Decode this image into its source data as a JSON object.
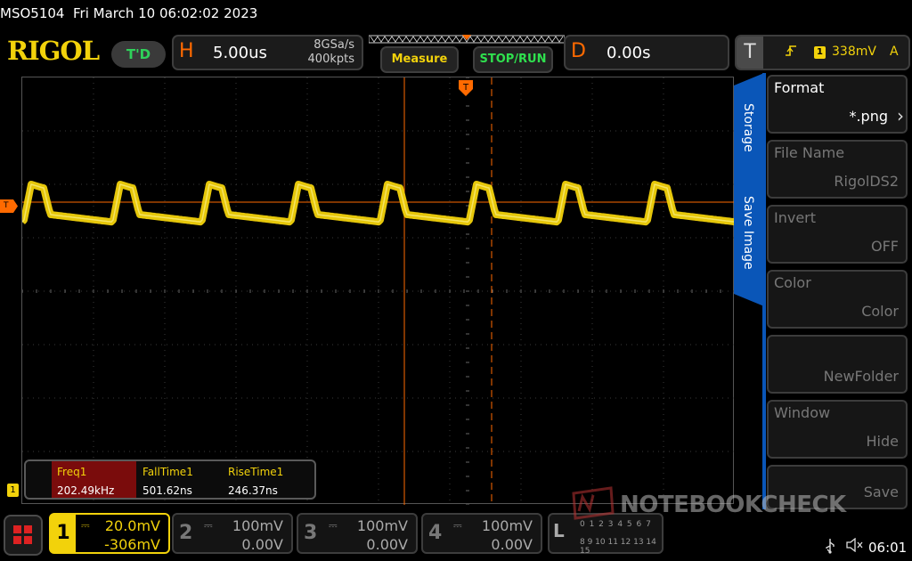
{
  "titlebar": {
    "device": "MSO5104",
    "datetime": "Fri March 10 06:02:02 2023"
  },
  "brand": {
    "logo": "RIGOL",
    "run_status": "T'D"
  },
  "horizontal": {
    "letter": "H",
    "timebase": "5.00us",
    "sample_rate": "8GSa/s",
    "memory_depth": "400kpts"
  },
  "buttons": {
    "measure": "Measure",
    "stop_run": "STOP/RUN"
  },
  "delay": {
    "letter": "D",
    "value": "0.00s"
  },
  "trigger": {
    "letter": "T",
    "edge_icon": "rising-edge-icon",
    "channel": "1",
    "level": "338mV",
    "mode": "A"
  },
  "markers": {
    "trigger_level": "T",
    "channel1": "1"
  },
  "measurements": [
    {
      "name": "Freq1",
      "value": "202.49kHz"
    },
    {
      "name": "FallTime1",
      "value": "501.62ns"
    },
    {
      "name": "RiseTime1",
      "value": "246.37ns"
    }
  ],
  "side_tabs": {
    "storage": "Storage",
    "save_image": "Save Image"
  },
  "menu": [
    {
      "label": "Format",
      "value": "*.png",
      "enabled": true
    },
    {
      "label": "File Name",
      "value": "RigolDS2",
      "enabled": false
    },
    {
      "label": "Invert",
      "value": "OFF",
      "enabled": false
    },
    {
      "label": "Color",
      "value": "Color",
      "enabled": false
    },
    {
      "label": "",
      "value": "NewFolder",
      "enabled": false
    },
    {
      "label": "Window",
      "value": "Hide",
      "enabled": false
    },
    {
      "label": "",
      "value": "Save",
      "enabled": false
    }
  ],
  "channels": [
    {
      "num": "1",
      "coupling": "⎓",
      "scale": "20.0mV",
      "offset": "-306mV",
      "active": true,
      "color": "#f2d20b"
    },
    {
      "num": "2",
      "coupling": "⎓",
      "scale": "100mV",
      "offset": "0.00V",
      "active": false
    },
    {
      "num": "3",
      "coupling": "⎓",
      "scale": "100mV",
      "offset": "0.00V",
      "active": false
    },
    {
      "num": "4",
      "coupling": "⎓",
      "scale": "100mV",
      "offset": "0.00V",
      "active": false
    }
  ],
  "la": {
    "letter": "L",
    "row1": "0 1 2 3 4 5 6 7",
    "row2": "8 9 10 11 12 13 14 15"
  },
  "watermark": "NOTEBOOKCHECK",
  "status": {
    "clock": "06:01",
    "usb_icon": "usb-icon",
    "speaker_icon": "speaker-muted-icon"
  },
  "colors": {
    "trace": "#f2d20b",
    "accent": "#ff6a00",
    "menu_blue": "#0a56b8",
    "grid": "#555555"
  }
}
